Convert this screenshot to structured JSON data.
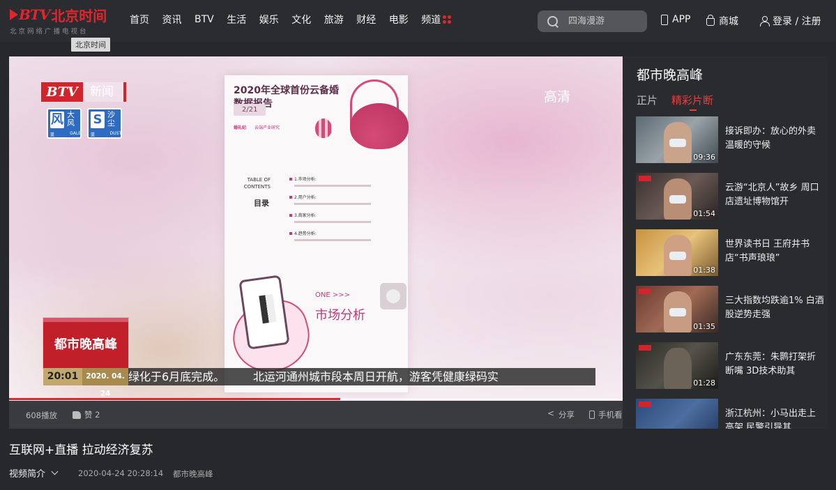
{
  "header": {
    "logo_btv": "BTV",
    "logo_name": "北京时间",
    "logo_sub": "北京网络广播电视台",
    "logo_tooltip": "北京时间",
    "nav": [
      "首页",
      "资讯",
      "BTV",
      "生活",
      "娱乐",
      "文化",
      "旅游",
      "财经",
      "电影",
      "频道"
    ],
    "search_placeholder": "四海漫游",
    "app_label": "APP",
    "shop_label": "商城",
    "login_label": "登录 / 注册"
  },
  "player": {
    "bug_btv": "BTV",
    "bug_channel": "新闻",
    "hd_label": "高清",
    "warnings": [
      {
        "icon": "风",
        "cn": "大风",
        "level": "蓝",
        "en": "GALE"
      },
      {
        "icon": "S",
        "cn": "沙尘",
        "level": "蓝",
        "en": "DUST"
      }
    ],
    "doc": {
      "title": "2020年全球首份云备婚数据报告",
      "page": "2/21",
      "brand1": "婚礼纪",
      "brand2": "云端产业研究",
      "toc_label": "TABLE OF CONTENTS",
      "toc_cn": "目录",
      "toc_items": [
        "1.市场分析:",
        "2.用户分析:",
        "3.商家分析:",
        "4.趋势分析:"
      ],
      "one": "ONE  >>>",
      "category": "市场分析"
    },
    "show_name": "都市晚高峰",
    "ticker_time": "20:01",
    "ticker_date": "2020. 04. 24",
    "ticker_text": "绿化于6月底完成。        北运河通州城市段本周日开航，游客凭健康绿码实",
    "progress_percent": 54
  },
  "player_bar": {
    "plays": "608播放",
    "like": "赞 2",
    "share": "分享",
    "mobile": "手机看"
  },
  "side": {
    "title": "都市晚高峰",
    "tabs": [
      "正片",
      "精彩片断"
    ],
    "videos": [
      {
        "title": "接诉即办：放心的外卖 温暖的守候",
        "duration": "09:36"
      },
      {
        "title": "云游“北京人”故乡 周口店遗址博物馆开",
        "duration": "01:54"
      },
      {
        "title": "世界读书日 王府井书店“书声琅琅”",
        "duration": "01:38"
      },
      {
        "title": "三大指数均跌逾1% 白酒股逆势走强",
        "duration": "01:35"
      },
      {
        "title": "广东东莞：朱鹮打架折断嘴 3D技术助其",
        "duration": "01:28"
      },
      {
        "title": "浙江杭州：小马出走上高架 民警引导其",
        "duration": ""
      }
    ]
  },
  "main": {
    "title": "互联网+直播 拉动经济复苏",
    "intro_label": "视频简介",
    "date": "2020-04-24 20:28:14",
    "column": "都市晚高峰"
  },
  "colors": {
    "brand_red": "#e0262d",
    "accent_red": "#ef3c3c",
    "bg": "#27282c"
  }
}
